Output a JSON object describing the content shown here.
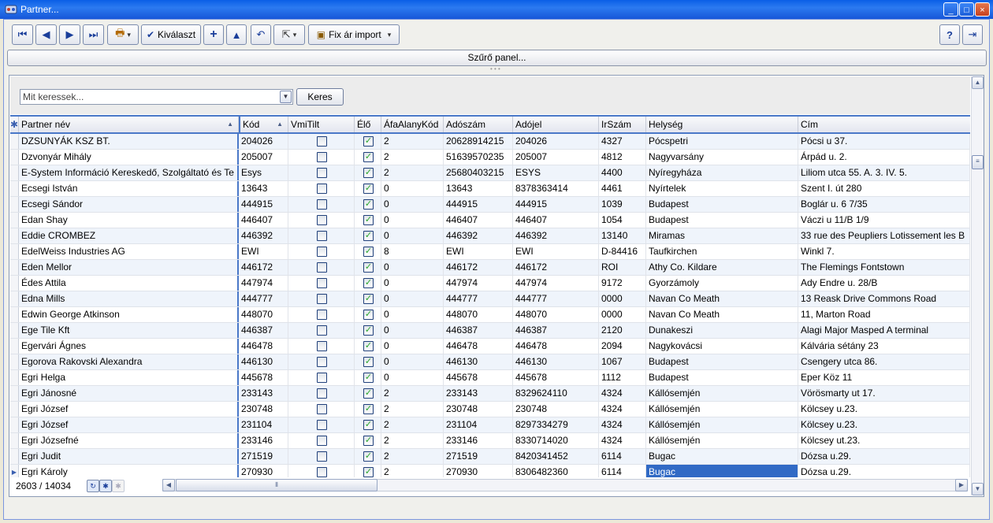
{
  "window": {
    "title": "Partner...",
    "minimize": "_",
    "maximize": "□",
    "close": "×"
  },
  "toolbar": {
    "kivalaszt_label": "Kiválaszt",
    "fix_ar_import_label": "Fix ár import"
  },
  "filter_panel_label": "Szűrő panel...",
  "search": {
    "placeholder": "Mit keressek...",
    "button_label": "Keres"
  },
  "columns": [
    "Partner név",
    "Kód",
    "VmiTilt",
    "Élő",
    "ÁfaAlanyKód",
    "Adószám",
    "Adójel",
    "IrSzám",
    "Helység",
    "Cím"
  ],
  "rows": [
    {
      "nev": "DZSUNYÁK KSZ BT.",
      "kod": "204026",
      "vmitilt": false,
      "elo": true,
      "afa": "2",
      "adoszam": "20628914215",
      "adojel": "204026",
      "irszam": "4327",
      "helyseg": "Pócspetri",
      "cim": "Pócsi u 37."
    },
    {
      "nev": "Dzvonyár Mihály",
      "kod": "205007",
      "vmitilt": false,
      "elo": true,
      "afa": "2",
      "adoszam": "51639570235",
      "adojel": "205007",
      "irszam": "4812",
      "helyseg": "Nagyvarsány",
      "cim": "Árpád u. 2."
    },
    {
      "nev": "E-System Információ Kereskedő, Szolgáltató és Te",
      "kod": "Esys",
      "vmitilt": false,
      "elo": true,
      "afa": "2",
      "adoszam": "25680403215",
      "adojel": "ESYS",
      "irszam": "4400",
      "helyseg": "Nyíregyháza",
      "cim": "Liliom  utca 55. A. 3. IV. 5."
    },
    {
      "nev": "Ecsegi István",
      "kod": "13643",
      "vmitilt": false,
      "elo": true,
      "afa": "0",
      "adoszam": "13643",
      "adojel": "8378363414",
      "irszam": "4461",
      "helyseg": "Nyírtelek",
      "cim": "Szent I. út 280"
    },
    {
      "nev": "Ecsegi Sándor",
      "kod": "444915",
      "vmitilt": false,
      "elo": true,
      "afa": "0",
      "adoszam": "444915",
      "adojel": "444915",
      "irszam": "1039",
      "helyseg": "Budapest",
      "cim": "Boglár u. 6 7/35"
    },
    {
      "nev": "Edan Shay",
      "kod": "446407",
      "vmitilt": false,
      "elo": true,
      "afa": "0",
      "adoszam": "446407",
      "adojel": "446407",
      "irszam": "1054",
      "helyseg": "Budapest",
      "cim": "Váczi u 11/B 1/9"
    },
    {
      "nev": "Eddie CROMBEZ",
      "kod": "446392",
      "vmitilt": false,
      "elo": true,
      "afa": "0",
      "adoszam": "446392",
      "adojel": "446392",
      "irszam": "13140",
      "helyseg": "Miramas",
      "cim": "33 rue des Peupliers Lotissement les B"
    },
    {
      "nev": "EdelWeiss Industries AG",
      "kod": "EWI",
      "vmitilt": false,
      "elo": true,
      "afa": "8",
      "adoszam": "EWI",
      "adojel": "EWI",
      "irszam": "D-84416",
      "helyseg": "Taufkirchen",
      "cim": "Winkl 7."
    },
    {
      "nev": "Eden Mellor",
      "kod": "446172",
      "vmitilt": false,
      "elo": true,
      "afa": "0",
      "adoszam": "446172",
      "adojel": "446172",
      "irszam": "ROI",
      "helyseg": "Athy Co. Kildare",
      "cim": "The Flemings Fontstown"
    },
    {
      "nev": "Édes Attila",
      "kod": "447974",
      "vmitilt": false,
      "elo": true,
      "afa": "0",
      "adoszam": "447974",
      "adojel": "447974",
      "irszam": "9172",
      "helyseg": "Gyorzámoly",
      "cim": "Ady Endre u. 28/B"
    },
    {
      "nev": "Edna Mills",
      "kod": "444777",
      "vmitilt": false,
      "elo": true,
      "afa": "0",
      "adoszam": "444777",
      "adojel": "444777",
      "irszam": "0000",
      "helyseg": "Navan Co Meath",
      "cim": "13 Reask Drive Commons Road"
    },
    {
      "nev": "Edwin George Atkinson",
      "kod": "448070",
      "vmitilt": false,
      "elo": true,
      "afa": "0",
      "adoszam": "448070",
      "adojel": "448070",
      "irszam": "0000",
      "helyseg": "Navan Co Meath",
      "cim": "11, Marton Road"
    },
    {
      "nev": "Ege Tile Kft",
      "kod": "446387",
      "vmitilt": false,
      "elo": true,
      "afa": "0",
      "adoszam": "446387",
      "adojel": "446387",
      "irszam": "2120",
      "helyseg": "Dunakeszi",
      "cim": "Alagi Major Masped A terminal"
    },
    {
      "nev": "Egervári Ágnes",
      "kod": "446478",
      "vmitilt": false,
      "elo": true,
      "afa": "0",
      "adoszam": "446478",
      "adojel": "446478",
      "irszam": "2094",
      "helyseg": "Nagykovácsi",
      "cim": "Kálvária sétány 23"
    },
    {
      "nev": "Egorova Rakovski Alexandra",
      "kod": "446130",
      "vmitilt": false,
      "elo": true,
      "afa": "0",
      "adoszam": "446130",
      "adojel": "446130",
      "irszam": "1067",
      "helyseg": "Budapest",
      "cim": "Csengery utca 86."
    },
    {
      "nev": "Egri Helga",
      "kod": "445678",
      "vmitilt": false,
      "elo": true,
      "afa": "0",
      "adoszam": "445678",
      "adojel": "445678",
      "irszam": "1112",
      "helyseg": "Budapest",
      "cim": "Eper Köz 11"
    },
    {
      "nev": "Egri Jánosné",
      "kod": "233143",
      "vmitilt": false,
      "elo": true,
      "afa": "2",
      "adoszam": "233143",
      "adojel": "8329624110",
      "irszam": "4324",
      "helyseg": "Kállósemjén",
      "cim": "Vörösmarty ut 17."
    },
    {
      "nev": "Egri József",
      "kod": "230748",
      "vmitilt": false,
      "elo": true,
      "afa": "2",
      "adoszam": "230748",
      "adojel": "230748",
      "irszam": "4324",
      "helyseg": "Kállósemjén",
      "cim": "Kölcsey u.23."
    },
    {
      "nev": "Egri József",
      "kod": "231104",
      "vmitilt": false,
      "elo": true,
      "afa": "2",
      "adoszam": "231104",
      "adojel": "8297334279",
      "irszam": "4324",
      "helyseg": "Kállósemjén",
      "cim": "Kölcsey u.23."
    },
    {
      "nev": "Egri Józsefné",
      "kod": "233146",
      "vmitilt": false,
      "elo": true,
      "afa": "2",
      "adoszam": "233146",
      "adojel": "8330714020",
      "irszam": "4324",
      "helyseg": "Kállósemjén",
      "cim": "Kölcsey ut.23."
    },
    {
      "nev": "Egri Judit",
      "kod": "271519",
      "vmitilt": false,
      "elo": true,
      "afa": "2",
      "adoszam": "271519",
      "adojel": "8420341452",
      "irszam": "6114",
      "helyseg": "Bugac",
      "cim": "Dózsa u.29."
    },
    {
      "nev": "Egri Károly",
      "kod": "270930",
      "vmitilt": false,
      "elo": true,
      "afa": "2",
      "adoszam": "270930",
      "adojel": "8306482360",
      "irszam": "6114",
      "helyseg": "Bugac",
      "cim": "Dózsa u.29.",
      "current": true
    }
  ],
  "status": {
    "record_counter": "2603 / 14034"
  }
}
